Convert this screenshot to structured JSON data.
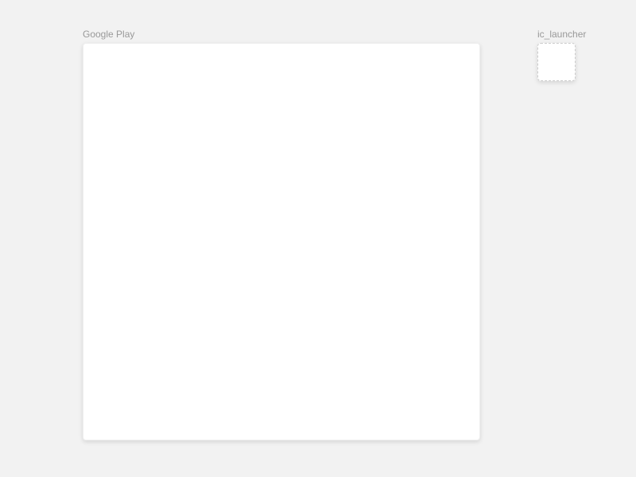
{
  "assets": {
    "main": {
      "label": "Google Play"
    },
    "launcher": {
      "label": "ic_launcher"
    }
  }
}
